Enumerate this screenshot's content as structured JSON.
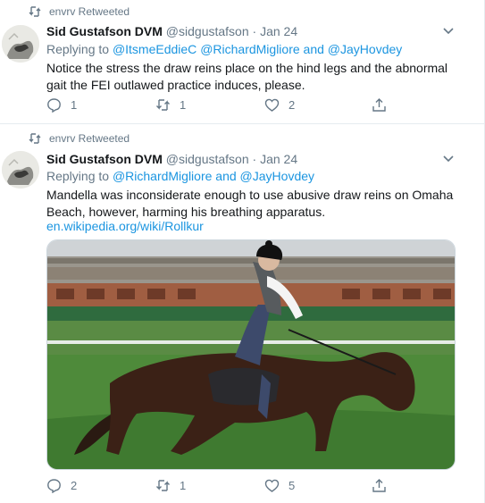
{
  "tweets": [
    {
      "retweeted_by": "envrv Retweeted",
      "author_name": "Sid Gustafson DVM",
      "author_handle": "@sidgustafson",
      "separator": "·",
      "date": "Jan 24",
      "replying_prefix": "Replying to",
      "mentions": [
        "@ItsmeEddieC",
        "@RichardMigliore"
      ],
      "and_word": "and",
      "last_mention": "@JayHovdey",
      "text": "Notice the stress the draw reins place on the hind legs and the abnormal gait the FEI outlawed practice induces, please.",
      "counts": {
        "reply": "1",
        "retweet": "1",
        "like": "2"
      }
    },
    {
      "retweeted_by": "envrv Retweeted",
      "author_name": "Sid Gustafson DVM",
      "author_handle": "@sidgustafson",
      "separator": "·",
      "date": "Jan 24",
      "replying_prefix": "Replying to",
      "mentions": [
        "@RichardMigliore"
      ],
      "and_word": "and",
      "last_mention": "@JayHovdey",
      "text": "Mandella was inconsiderate enough to use abusive draw reins on Omaha Beach, however, harming his breathing apparatus.",
      "link": "en.wikipedia.org/wiki/Rollkur",
      "counts": {
        "reply": "2",
        "retweet": "1",
        "like": "5"
      }
    }
  ],
  "icons": {
    "retweet_small": "retweet-icon",
    "reply": "reply-icon",
    "retweet": "retweet-icon",
    "like": "heart-icon",
    "share": "share-icon",
    "caret": "chevron-down-icon"
  },
  "colors": {
    "link": "#1b95e0",
    "muted": "#657786",
    "text": "#14171a",
    "divider": "#e6ecf0"
  }
}
